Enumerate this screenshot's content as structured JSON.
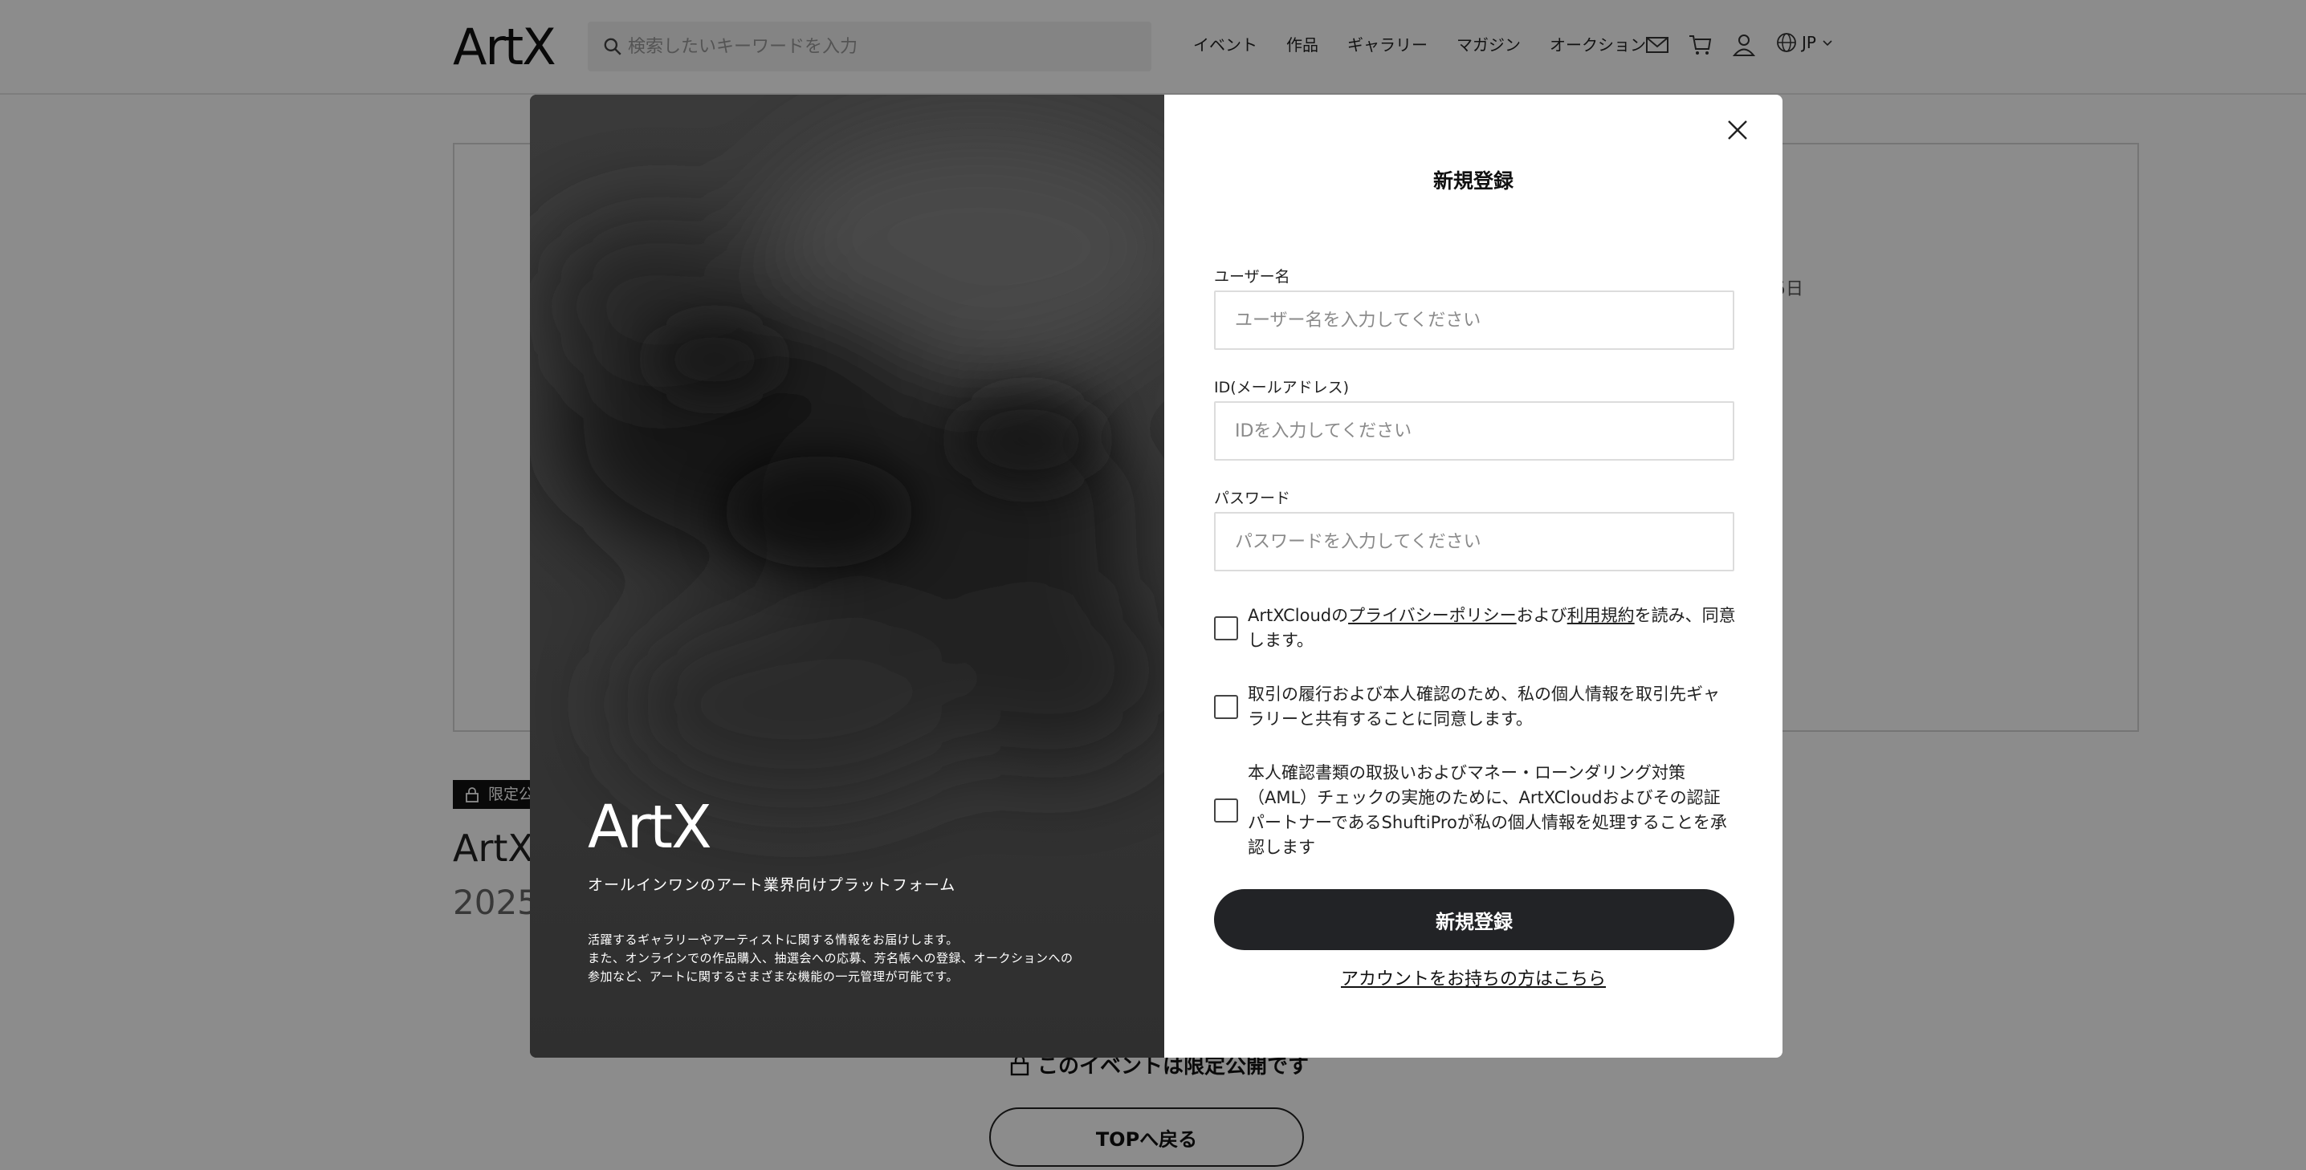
{
  "header": {
    "logo": "ArtX",
    "search_placeholder": "検索したいキーワードを入力",
    "nav": [
      "イベント",
      "作品",
      "ギャラリー",
      "マガジン",
      "オークション"
    ],
    "icons": [
      "mail-icon",
      "cart-icon",
      "user-icon",
      "globe-icon"
    ],
    "language": "JP"
  },
  "background": {
    "badge": "限定公",
    "title": "ArtX",
    "year": "2025",
    "day_fragment": "5日",
    "limited_notice": "このイベントは限定公開です",
    "back_button": "TOPへ戻る"
  },
  "modal": {
    "panel": {
      "logo": "ArtX",
      "tagline": "オールインワンのアート業界向けプラットフォーム",
      "description": [
        "活躍するギャラリーやアーティストに関する情報をお届けします。",
        "また、オンラインでの作品購入、抽選会への応募、芳名帳への登録、オークションへの",
        "参加など、アートに関するさまざまな機能の一元管理が可能です。"
      ]
    },
    "form": {
      "title": "新規登録",
      "username": {
        "label": "ユーザー名",
        "placeholder": "ユーザー名を入力してください",
        "value": ""
      },
      "email": {
        "label": "ID(メールアドレス)",
        "placeholder": "IDを入力してください",
        "value": ""
      },
      "password": {
        "label": "パスワード",
        "placeholder": "パスワードを入力してください",
        "value": ""
      },
      "consent_privacy": {
        "prefix": "ArtXCloudの",
        "privacy_link": "プライバシーポリシー",
        "middle": "および",
        "terms_link": "利用規約",
        "suffix": "を読み、同意します。",
        "checked": false
      },
      "consent_sharing": {
        "text": "取引の履行および本人確認のため、私の個人情報を取引先ギャラリーと共有することに同意します。",
        "checked": false
      },
      "consent_aml": {
        "text": "本人確認書類の取扱いおよびマネー・ローンダリング対策（AML）チェックの実施のために、ArtXCloudおよびその認証パートナーであるShuftiProが私の個人情報を処理することを承認します",
        "checked": false
      },
      "submit": "新規登録",
      "login_link": "アカウントをお持ちの方はこちら"
    }
  }
}
